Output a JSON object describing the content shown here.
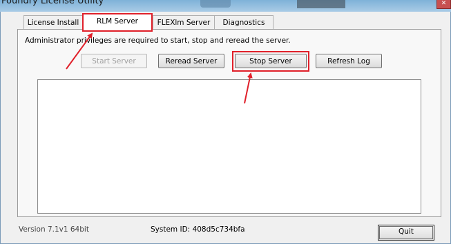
{
  "window": {
    "title": "Foundry License Utility",
    "close_icon": "close-icon"
  },
  "tabs": [
    {
      "label": "License Install"
    },
    {
      "label": "RLM Server"
    },
    {
      "label": "FLEXlm Server"
    },
    {
      "label": "Diagnostics"
    }
  ],
  "active_tab": "RLM Server",
  "panel": {
    "notice": "Administrator privileges are required to start, stop and reread the server.",
    "buttons": {
      "start": "Start Server",
      "reread": "Reread Server",
      "stop": "Stop Server",
      "refresh": "Refresh Log"
    },
    "log_text": ""
  },
  "footer": {
    "version": "Version 7.1v1 64bit",
    "system_id_label": "System ID:",
    "system_id_value": "408d5c734bfa",
    "quit": "Quit"
  },
  "annotation_color": "#e0202a"
}
